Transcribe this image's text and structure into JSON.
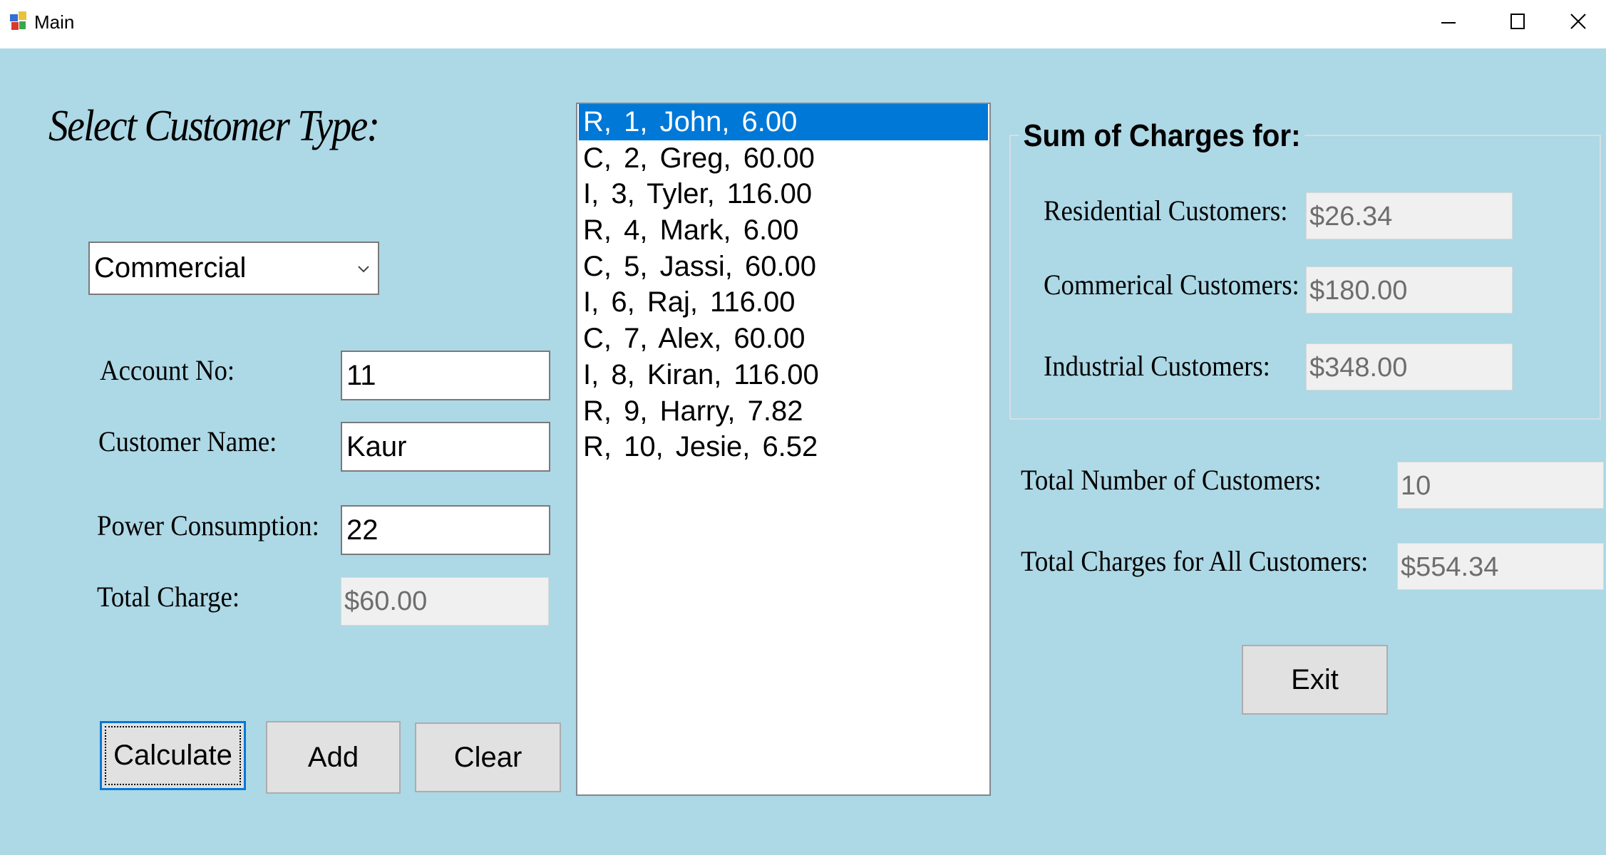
{
  "window": {
    "title": "Main",
    "controls": [
      "minimize-icon",
      "maximize-icon",
      "close-icon"
    ]
  },
  "heading": "Select Customer Type:",
  "customer_type": {
    "selected": "Commercial"
  },
  "form": {
    "account_no": {
      "label": "Account No:",
      "value": "11"
    },
    "customer_name": {
      "label": "Customer Name:",
      "value": "Kaur"
    },
    "power_consumption": {
      "label": "Power Consumption:",
      "value": "22"
    },
    "total_charge": {
      "label": "Total Charge:",
      "value": "$60.00"
    }
  },
  "buttons": {
    "calculate": "Calculate",
    "add": "Add",
    "clear": "Clear",
    "exit": "Exit"
  },
  "customer_list": {
    "selected_index": 0,
    "items": [
      "R, 1, John, 6.00",
      "C, 2, Greg, 60.00",
      "I, 3, Tyler, 116.00",
      "R, 4, Mark, 6.00",
      "C, 5, Jassi, 60.00",
      "I, 6, Raj, 116.00",
      "C, 7, Alex, 60.00",
      "I, 8, Kiran, 116.00",
      "R, 9, Harry, 7.82",
      "R, 10, Jesie, 6.52"
    ]
  },
  "sum_of_charges": {
    "title": "Sum of Charges for:",
    "residential": {
      "label": "Residential Customers:",
      "value": "$26.34"
    },
    "commercial": {
      "label": "Commerical Customers:",
      "value": "$180.00"
    },
    "industrial": {
      "label": "Industrial Customers:",
      "value": "$348.00"
    }
  },
  "totals": {
    "customers": {
      "label": "Total Number of Customers:",
      "value": "10"
    },
    "charges": {
      "label": "Total Charges for All Customers:",
      "value": "$554.34"
    }
  },
  "colors": {
    "background": "#add8e6",
    "selection": "#0078d7"
  }
}
